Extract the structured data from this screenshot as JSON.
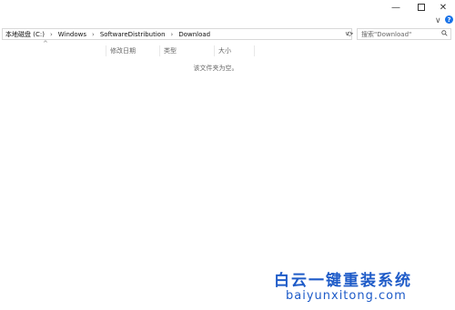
{
  "window": {
    "minimize_glyph": "—",
    "close_glyph": "✕"
  },
  "ribbon": {
    "expand_glyph": "∨",
    "help_glyph": "?"
  },
  "address": {
    "crumbs": [
      "本地磁盘 (C:)",
      "Windows",
      "SoftwareDistribution",
      "Download"
    ],
    "separator": "›",
    "dropdown_glyph": "∨"
  },
  "search": {
    "placeholder": "搜索\"Download\""
  },
  "columns": {
    "date": "修改日期",
    "type": "类型",
    "size": "大小"
  },
  "sort_glyph": "^",
  "content": {
    "empty_message": "该文件夹为空。"
  },
  "watermark": {
    "title": "白云一键重装系统",
    "url": "baiyunxitong.com"
  },
  "colors": {
    "accent": "#1e5bc8",
    "help": "#1a73e8"
  }
}
